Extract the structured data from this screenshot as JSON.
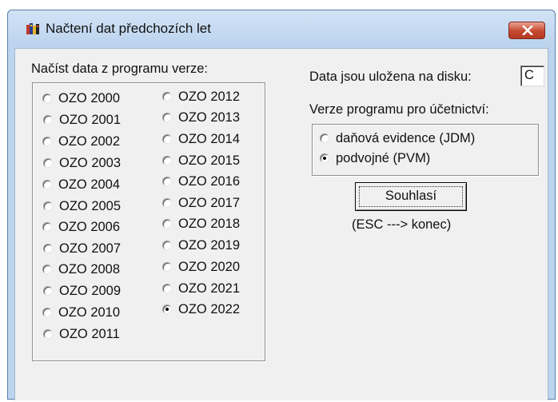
{
  "window": {
    "title": "Načtení dat předchozích let",
    "icon": "app-book-icon",
    "close_icon": "close-icon"
  },
  "left": {
    "label": "Načíst data z programu verze:",
    "versions": [
      {
        "label": "OZO 2000",
        "checked": false
      },
      {
        "label": "OZO 2001",
        "checked": false
      },
      {
        "label": "OZO 2002",
        "checked": false
      },
      {
        "label": "OZO 2003",
        "checked": false
      },
      {
        "label": "OZO 2004",
        "checked": false
      },
      {
        "label": "OZO 2005",
        "checked": false
      },
      {
        "label": "OZO 2006",
        "checked": false
      },
      {
        "label": "OZO 2007",
        "checked": false
      },
      {
        "label": "OZO 2008",
        "checked": false
      },
      {
        "label": "OZO 2009",
        "checked": false
      },
      {
        "label": "OZO 2010",
        "checked": false
      },
      {
        "label": "OZO 2011",
        "checked": false
      },
      {
        "label": "OZO 2012",
        "checked": false
      },
      {
        "label": "OZO 2013",
        "checked": false
      },
      {
        "label": "OZO 2014",
        "checked": false
      },
      {
        "label": "OZO 2015",
        "checked": false
      },
      {
        "label": "OZO 2016",
        "checked": false
      },
      {
        "label": "OZO 2017",
        "checked": false
      },
      {
        "label": "OZO 2018",
        "checked": false
      },
      {
        "label": "OZO 2019",
        "checked": false
      },
      {
        "label": "OZO 2020",
        "checked": false
      },
      {
        "label": "OZO 2021",
        "checked": false
      },
      {
        "label": "OZO 2022",
        "checked": true
      }
    ]
  },
  "right": {
    "disk_label": "Data jsou uložena na disku:",
    "disk_value": "C",
    "accounting_label": "Verze programu pro účetnictví:",
    "accounting_options": [
      {
        "label": "daňová evidence (JDM)",
        "checked": false
      },
      {
        "label": "podvojné (PVM)",
        "checked": true
      }
    ],
    "confirm_button": "Souhlasí",
    "hint": "(ESC ---> konec)"
  },
  "colors": {
    "frame": "#bcd4ee",
    "client": "#f0f0f0",
    "close_button": "#c5482f"
  }
}
